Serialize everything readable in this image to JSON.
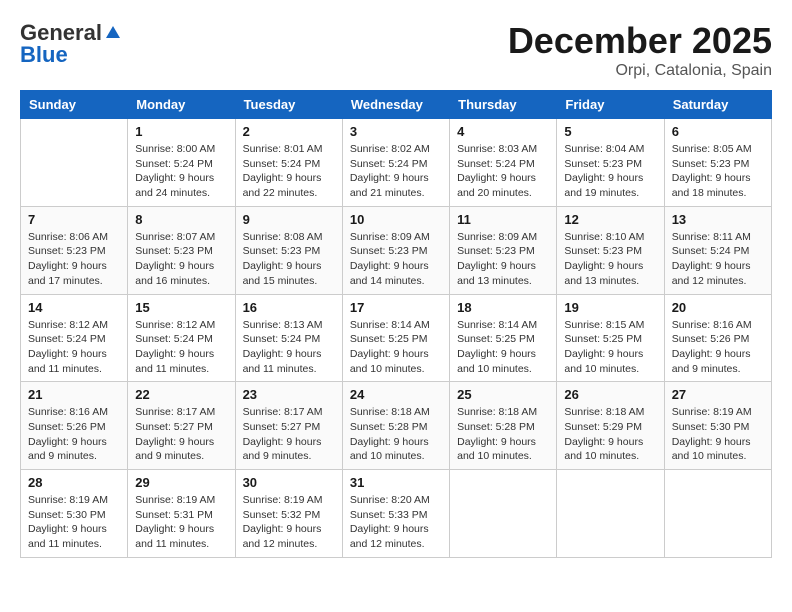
{
  "logo": {
    "general": "General",
    "blue": "Blue"
  },
  "title": "December 2025",
  "location": "Orpi, Catalonia, Spain",
  "days_header": [
    "Sunday",
    "Monday",
    "Tuesday",
    "Wednesday",
    "Thursday",
    "Friday",
    "Saturday"
  ],
  "weeks": [
    [
      {
        "day": "",
        "info": ""
      },
      {
        "day": "1",
        "info": "Sunrise: 8:00 AM\nSunset: 5:24 PM\nDaylight: 9 hours\nand 24 minutes."
      },
      {
        "day": "2",
        "info": "Sunrise: 8:01 AM\nSunset: 5:24 PM\nDaylight: 9 hours\nand 22 minutes."
      },
      {
        "day": "3",
        "info": "Sunrise: 8:02 AM\nSunset: 5:24 PM\nDaylight: 9 hours\nand 21 minutes."
      },
      {
        "day": "4",
        "info": "Sunrise: 8:03 AM\nSunset: 5:24 PM\nDaylight: 9 hours\nand 20 minutes."
      },
      {
        "day": "5",
        "info": "Sunrise: 8:04 AM\nSunset: 5:23 PM\nDaylight: 9 hours\nand 19 minutes."
      },
      {
        "day": "6",
        "info": "Sunrise: 8:05 AM\nSunset: 5:23 PM\nDaylight: 9 hours\nand 18 minutes."
      }
    ],
    [
      {
        "day": "7",
        "info": "Sunrise: 8:06 AM\nSunset: 5:23 PM\nDaylight: 9 hours\nand 17 minutes."
      },
      {
        "day": "8",
        "info": "Sunrise: 8:07 AM\nSunset: 5:23 PM\nDaylight: 9 hours\nand 16 minutes."
      },
      {
        "day": "9",
        "info": "Sunrise: 8:08 AM\nSunset: 5:23 PM\nDaylight: 9 hours\nand 15 minutes."
      },
      {
        "day": "10",
        "info": "Sunrise: 8:09 AM\nSunset: 5:23 PM\nDaylight: 9 hours\nand 14 minutes."
      },
      {
        "day": "11",
        "info": "Sunrise: 8:09 AM\nSunset: 5:23 PM\nDaylight: 9 hours\nand 13 minutes."
      },
      {
        "day": "12",
        "info": "Sunrise: 8:10 AM\nSunset: 5:23 PM\nDaylight: 9 hours\nand 13 minutes."
      },
      {
        "day": "13",
        "info": "Sunrise: 8:11 AM\nSunset: 5:24 PM\nDaylight: 9 hours\nand 12 minutes."
      }
    ],
    [
      {
        "day": "14",
        "info": "Sunrise: 8:12 AM\nSunset: 5:24 PM\nDaylight: 9 hours\nand 11 minutes."
      },
      {
        "day": "15",
        "info": "Sunrise: 8:12 AM\nSunset: 5:24 PM\nDaylight: 9 hours\nand 11 minutes."
      },
      {
        "day": "16",
        "info": "Sunrise: 8:13 AM\nSunset: 5:24 PM\nDaylight: 9 hours\nand 11 minutes."
      },
      {
        "day": "17",
        "info": "Sunrise: 8:14 AM\nSunset: 5:25 PM\nDaylight: 9 hours\nand 10 minutes."
      },
      {
        "day": "18",
        "info": "Sunrise: 8:14 AM\nSunset: 5:25 PM\nDaylight: 9 hours\nand 10 minutes."
      },
      {
        "day": "19",
        "info": "Sunrise: 8:15 AM\nSunset: 5:25 PM\nDaylight: 9 hours\nand 10 minutes."
      },
      {
        "day": "20",
        "info": "Sunrise: 8:16 AM\nSunset: 5:26 PM\nDaylight: 9 hours\nand 9 minutes."
      }
    ],
    [
      {
        "day": "21",
        "info": "Sunrise: 8:16 AM\nSunset: 5:26 PM\nDaylight: 9 hours\nand 9 minutes."
      },
      {
        "day": "22",
        "info": "Sunrise: 8:17 AM\nSunset: 5:27 PM\nDaylight: 9 hours\nand 9 minutes."
      },
      {
        "day": "23",
        "info": "Sunrise: 8:17 AM\nSunset: 5:27 PM\nDaylight: 9 hours\nand 9 minutes."
      },
      {
        "day": "24",
        "info": "Sunrise: 8:18 AM\nSunset: 5:28 PM\nDaylight: 9 hours\nand 10 minutes."
      },
      {
        "day": "25",
        "info": "Sunrise: 8:18 AM\nSunset: 5:28 PM\nDaylight: 9 hours\nand 10 minutes."
      },
      {
        "day": "26",
        "info": "Sunrise: 8:18 AM\nSunset: 5:29 PM\nDaylight: 9 hours\nand 10 minutes."
      },
      {
        "day": "27",
        "info": "Sunrise: 8:19 AM\nSunset: 5:30 PM\nDaylight: 9 hours\nand 10 minutes."
      }
    ],
    [
      {
        "day": "28",
        "info": "Sunrise: 8:19 AM\nSunset: 5:30 PM\nDaylight: 9 hours\nand 11 minutes."
      },
      {
        "day": "29",
        "info": "Sunrise: 8:19 AM\nSunset: 5:31 PM\nDaylight: 9 hours\nand 11 minutes."
      },
      {
        "day": "30",
        "info": "Sunrise: 8:19 AM\nSunset: 5:32 PM\nDaylight: 9 hours\nand 12 minutes."
      },
      {
        "day": "31",
        "info": "Sunrise: 8:20 AM\nSunset: 5:33 PM\nDaylight: 9 hours\nand 12 minutes."
      },
      {
        "day": "",
        "info": ""
      },
      {
        "day": "",
        "info": ""
      },
      {
        "day": "",
        "info": ""
      }
    ]
  ]
}
